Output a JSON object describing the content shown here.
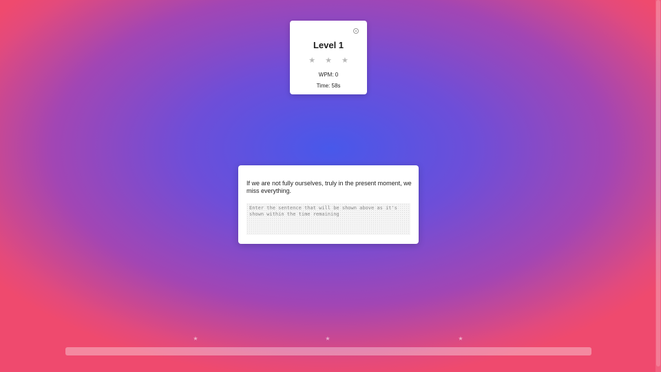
{
  "level_card": {
    "title": "Level 1",
    "stars": [
      "★",
      "★",
      "★"
    ],
    "stars_earned": 0,
    "wpm": "WPM: 0",
    "time": "Time: 58s",
    "settings_icon": "settings-icon"
  },
  "typing_card": {
    "sentence": "If we are not fully ourselves, truly in the present moment, we miss everything.",
    "input_value": "",
    "input_placeholder": "Enter the sentence that will be shown above as it's shown within the time remaining"
  },
  "progress": {
    "fraction": 0,
    "markers": [
      "★",
      "★",
      "★"
    ]
  },
  "colors": {
    "background_center": "#4858ea",
    "background_edge": "#ef4a6e",
    "card": "#ffffff",
    "star_inactive": "#b8b8b8"
  }
}
